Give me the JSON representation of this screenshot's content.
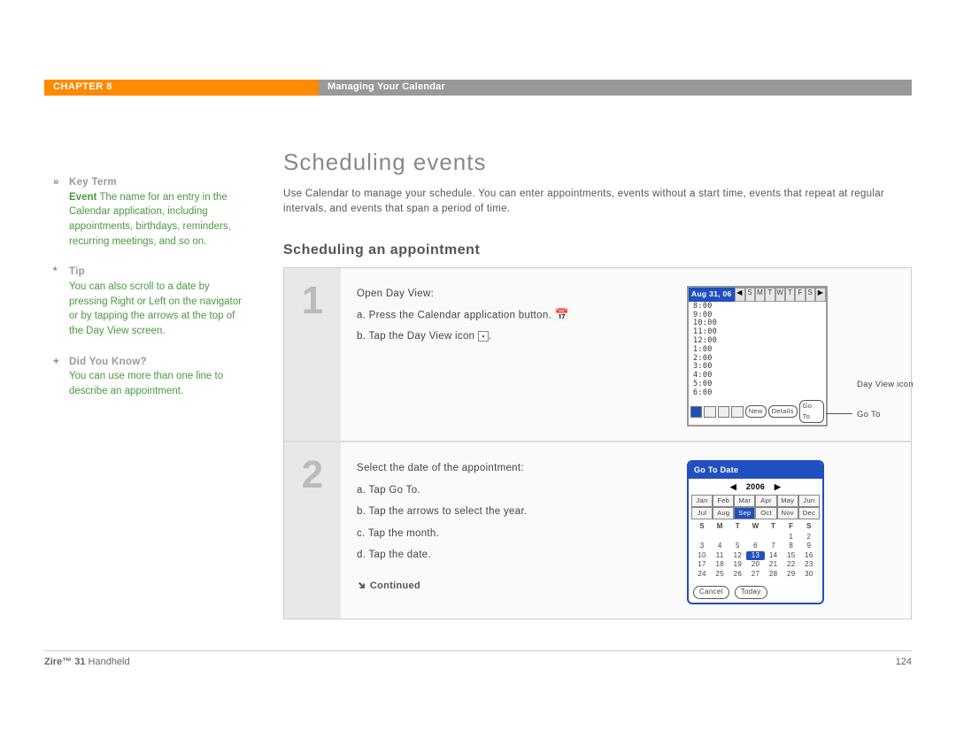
{
  "header": {
    "chapter": "CHAPTER 8",
    "title": "Managing Your Calendar"
  },
  "sidebar": {
    "keyterm": {
      "marker": "»",
      "title": "Key Term",
      "bold": "Event",
      "body": "   The name for an entry in the Calendar application, including appointments, birthdays, reminders, recurring meetings, and so on."
    },
    "tip": {
      "marker": "*",
      "title": "Tip",
      "body": "You can also scroll to a date by pressing Right or Left on the navigator or by tapping the arrows at the top of the Day View screen."
    },
    "didyouknow": {
      "marker": "+",
      "title": "Did You Know?",
      "body": "You can use more than one line to describe an appointment."
    }
  },
  "main": {
    "h1": "Scheduling events",
    "intro": "Use Calendar to manage your schedule. You can enter appointments, events without a start time, events that repeat at regular intervals, and events that span a period of time.",
    "h2": "Scheduling an appointment"
  },
  "steps": [
    {
      "num": "1",
      "lines": [
        "Open Day View:",
        "a.  Press the Calendar application button.",
        "b.  Tap the Day View icon"
      ]
    },
    {
      "num": "2",
      "lines": [
        "Select the date of the appointment:",
        "a.  Tap Go To.",
        "b.  Tap the arrows to select the year.",
        "c.  Tap the month.",
        "d.  Tap the date."
      ]
    }
  ],
  "continued": "Continued",
  "dayview": {
    "date": "Aug 31, 06",
    "dows": [
      "S",
      "M",
      "T",
      "W",
      "T",
      "F",
      "S"
    ],
    "hours": [
      "8:00",
      "9:00",
      "10:00",
      "11:00",
      "12:00",
      "1:00",
      "2:00",
      "3:00",
      "4:00",
      "5:00",
      "6:00"
    ],
    "buttons": {
      "new": "New",
      "details": "Details",
      "goto": "Go To"
    },
    "callouts": {
      "dayview": "Day View icon",
      "goto": "Go To"
    }
  },
  "goto": {
    "title": "Go To Date",
    "year": "2006",
    "months": [
      "Jan",
      "Feb",
      "Mar",
      "Apr",
      "May",
      "Jun",
      "Jul",
      "Aug",
      "Sep",
      "Oct",
      "Nov",
      "Dec"
    ],
    "selected_month": "Sep",
    "dows": [
      "S",
      "M",
      "T",
      "W",
      "T",
      "F",
      "S"
    ],
    "days": [
      "",
      "",
      "",
      "",
      "",
      "1",
      "2",
      "3",
      "4",
      "5",
      "6",
      "7",
      "8",
      "9",
      "10",
      "11",
      "12",
      "13",
      "14",
      "15",
      "16",
      "17",
      "18",
      "19",
      "20",
      "21",
      "22",
      "23",
      "24",
      "25",
      "26",
      "27",
      "28",
      "29",
      "30"
    ],
    "selected_day": "13",
    "buttons": {
      "cancel": "Cancel",
      "today": "Today"
    }
  },
  "footer": {
    "left_bold": "Zire™ 31",
    "left_rest": " Handheld",
    "page": "124"
  }
}
